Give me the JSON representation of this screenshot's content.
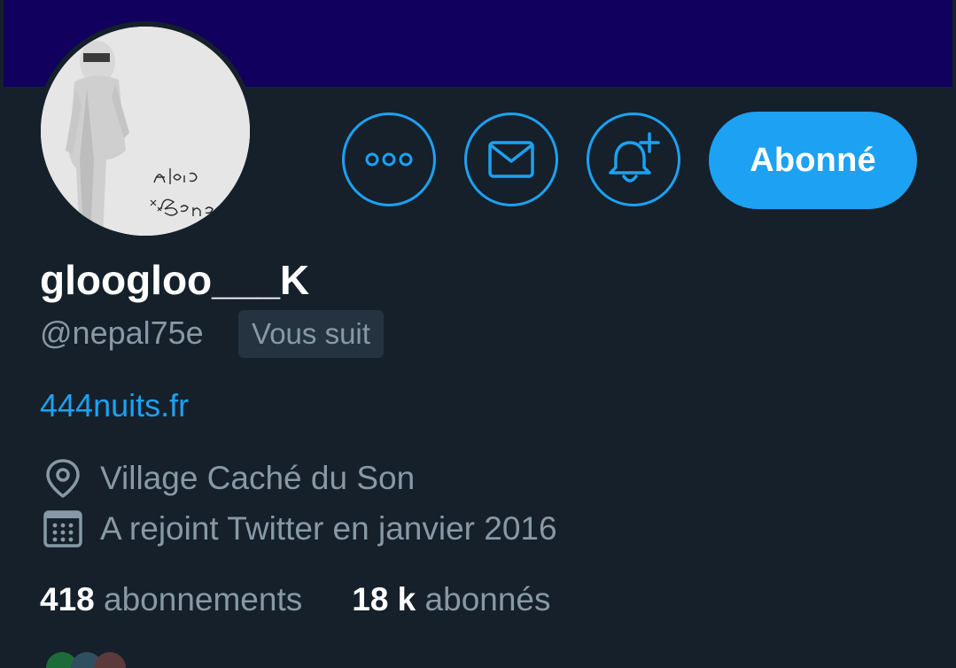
{
  "profile": {
    "display_name": "gloogloo___K",
    "handle": "@nepal75e",
    "follows_you_label": "Vous suit",
    "website": "444nuits.fr",
    "location": "Village Caché du Son",
    "joined": "A rejoint Twitter en janvier 2016",
    "avatar_signature": "Adiro Baha"
  },
  "actions": {
    "more_icon": "more-horizontal-icon",
    "message_icon": "mail-icon",
    "notify_icon": "bell-plus-icon",
    "follow_label": "Abonné"
  },
  "stats": {
    "following_count": "418",
    "following_label": "abonnements",
    "followers_count": "18 k",
    "followers_label": "abonnés"
  },
  "icons": {
    "location": "location-pin-icon",
    "joined": "calendar-icon"
  },
  "colors": {
    "background": "#15202b",
    "banner": "#12005e",
    "accent": "#1da1f2",
    "secondary_text": "#8899a6",
    "badge_bg": "#253341"
  }
}
